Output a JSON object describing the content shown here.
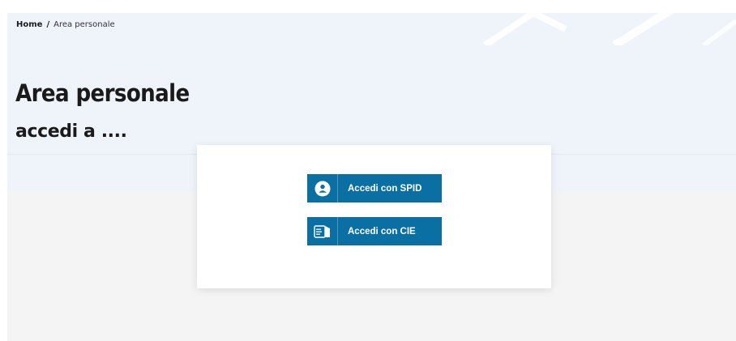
{
  "breadcrumb": {
    "home": "Home",
    "separator": "/",
    "current": "Area personale"
  },
  "header": {
    "title": "Area personale",
    "subtitle": "accedi a ...."
  },
  "login": {
    "spid_label": "Accedi con SPID",
    "spid_icon": "user-circle-icon",
    "cie_label": "Accedi con CIE",
    "cie_icon": "cie-id-card-icon"
  },
  "colors": {
    "hero_background": "#eff4fb",
    "lower_background": "#f4f4f4",
    "button_primary": "#0a6fa3",
    "text_dark": "#1a1a1a"
  }
}
